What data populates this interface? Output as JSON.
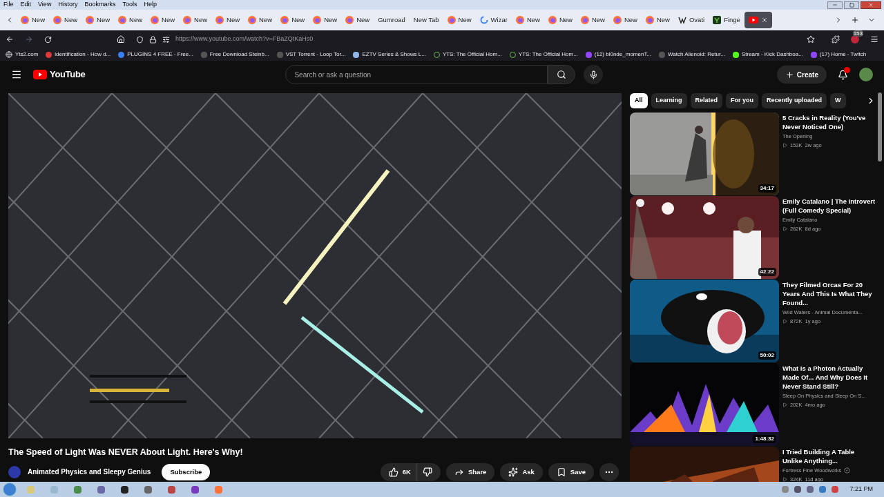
{
  "menu_bar": [
    "File",
    "Edit",
    "View",
    "History",
    "Bookmarks",
    "Tools",
    "Help"
  ],
  "tabs": [
    {
      "label": "New",
      "kind": "firefox",
      "selected": false
    },
    {
      "label": "New",
      "kind": "firefox",
      "selected": false
    },
    {
      "label": "New",
      "kind": "firefox",
      "selected": false
    },
    {
      "label": "New",
      "kind": "firefox",
      "selected": false
    },
    {
      "label": "New",
      "kind": "firefox",
      "selected": false
    },
    {
      "label": "New",
      "kind": "firefox",
      "selected": false
    },
    {
      "label": "New",
      "kind": "firefox",
      "selected": false
    },
    {
      "label": "New",
      "kind": "firefox",
      "selected": false
    },
    {
      "label": "New",
      "kind": "firefox",
      "selected": false
    },
    {
      "label": "New",
      "kind": "firefox",
      "selected": false
    },
    {
      "label": "New",
      "kind": "firefox",
      "selected": false
    },
    {
      "label": "Gumroad",
      "kind": "plain",
      "selected": false
    },
    {
      "label": "New Tab",
      "kind": "plain",
      "selected": false
    },
    {
      "label": "New",
      "kind": "firefox",
      "selected": false
    },
    {
      "label": "Wizar",
      "kind": "google",
      "selected": false
    },
    {
      "label": "New",
      "kind": "firefox",
      "selected": false
    },
    {
      "label": "New",
      "kind": "firefox",
      "selected": false
    },
    {
      "label": "New",
      "kind": "firefox",
      "selected": false
    },
    {
      "label": "New",
      "kind": "firefox",
      "selected": false
    },
    {
      "label": "New",
      "kind": "firefox",
      "selected": false
    },
    {
      "label": "Ovati",
      "kind": "wiki",
      "selected": false
    },
    {
      "label": "Finge",
      "kind": "yts",
      "selected": false
    },
    {
      "kind": "youtube",
      "selected": true
    }
  ],
  "address": "https://www.youtube.com/watch?v=FBaZQtKaHs0",
  "extension_badge": "153",
  "bookmarks": [
    {
      "label": "Yts2.com",
      "kind": "globe"
    },
    {
      "label": "identification - How d...",
      "kind": "red"
    },
    {
      "label": "PLUGINS 4 FREE - Free...",
      "kind": "blue"
    },
    {
      "label": "Free Download Steinb...",
      "kind": "dark"
    },
    {
      "label": "VST Torrent - Loop Tor...",
      "kind": "dark"
    },
    {
      "label": "EZTV Series & Shows L...",
      "kind": "eztv"
    },
    {
      "label": "YTS: The Official Hom...",
      "kind": "yts"
    },
    {
      "label": "YTS: The Official Hom...",
      "kind": "yts"
    },
    {
      "label": "(12) bl0nde_momenT...",
      "kind": "twitch"
    },
    {
      "label": "Watch Alienoid: Retur...",
      "kind": "dark"
    },
    {
      "label": "Stream - Kick Dashboa...",
      "kind": "kick"
    },
    {
      "label": "(17) Home - Twitch",
      "kind": "twitch"
    }
  ],
  "youtube": {
    "logo": "YouTube",
    "search_placeholder": "Search or ask a question",
    "create": "Create"
  },
  "video": {
    "kind": "picture",
    "title": "The Speed of Light Was NEVER About Light. Here's Why!",
    "channel": "Animated Physics and Sleepy Genius",
    "subscribe": "Subscribe",
    "actions": [
      {
        "kind": "like",
        "label": "6K"
      },
      {
        "kind": "dislike"
      },
      {
        "kind": "share",
        "label": "Share"
      },
      {
        "kind": "ask",
        "label": "Ask"
      },
      {
        "kind": "save",
        "label": "Save"
      },
      {
        "kind": "more"
      }
    ]
  },
  "chips": [
    {
      "label": "All",
      "selected": true
    },
    {
      "label": "Learning",
      "selected": false
    },
    {
      "label": "Related",
      "selected": false
    },
    {
      "label": "For you",
      "selected": false
    },
    {
      "label": "Recently uploaded",
      "selected": false
    },
    {
      "label": "W",
      "selected": false
    }
  ],
  "recommendations": [
    {
      "title": "5 Cracks in Reality (You've Never Noticed One)",
      "channel": "The Opening",
      "verified": false,
      "views": "153K",
      "age": "2w ago",
      "duration": "34:17"
    },
    {
      "title": "Emily Catalano | The Introvert (Full Comedy Special)",
      "channel": "Emily Catalano",
      "verified": false,
      "views": "262K",
      "age": "8d ago",
      "duration": "42:22"
    },
    {
      "title": "They Filmed Orcas For 20 Years And This Is What They Found...",
      "channel": "Wild Waters - Animal Documenta...",
      "verified": false,
      "views": "872K",
      "age": "1y ago",
      "duration": "50:02"
    },
    {
      "title": "What Is a Photon Actually Made Of... And Why Does It Never Stand Still?",
      "channel": "Sleep On Physics and Sleep On S...",
      "verified": false,
      "views": "202K",
      "age": "4mo ago",
      "duration": "1:48:32"
    },
    {
      "title": "I Tried Building A Table Unlike Anything...",
      "channel": "Fortress Fine Woodworks",
      "verified": true,
      "views": "324K",
      "age": "11d ago"
    }
  ],
  "clock": "7:21 PM"
}
